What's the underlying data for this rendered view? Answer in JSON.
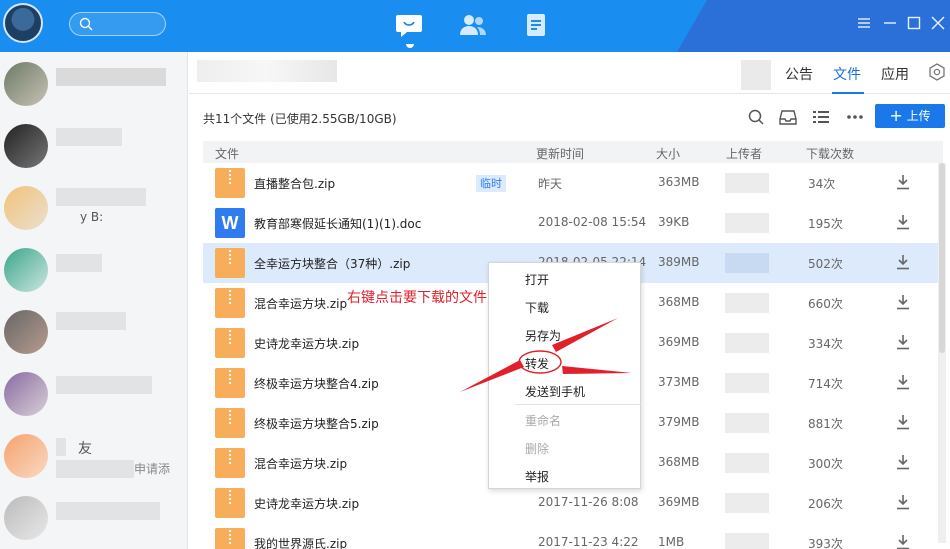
{
  "header": {
    "tabs": [
      {
        "label": "公告"
      },
      {
        "label": "文件"
      },
      {
        "label": "应用"
      }
    ]
  },
  "toolbar": {
    "summary": "共11个文件 (已使用2.55GB/10GB)",
    "upload_label": "上传"
  },
  "table": {
    "columns": [
      "文件",
      "更新时间",
      "大小",
      "上传者",
      "下载次数"
    ],
    "rows": [
      {
        "name": "直播整合包.zip",
        "tag": "临时",
        "time": "昨天",
        "size": "363MB",
        "downloads": "34次",
        "type": "zip"
      },
      {
        "name": "教育部寒假延长通知(1)(1).doc",
        "tag": "",
        "time": "2018-02-08 15:54",
        "size": "39KB",
        "downloads": "195次",
        "type": "doc",
        "icon_letter": "W"
      },
      {
        "name": "全幸运方块整合（37种）.zip",
        "tag": "",
        "time": "2018-02-05 22:14",
        "size": "389MB",
        "downloads": "502次",
        "type": "zip"
      },
      {
        "name": "混合幸运方块.zip",
        "tag": "",
        "time": "",
        "size": "368MB",
        "downloads": "660次",
        "type": "zip"
      },
      {
        "name": "史诗龙幸运方块.zip",
        "tag": "",
        "time": "",
        "size": "369MB",
        "downloads": "334次",
        "type": "zip"
      },
      {
        "name": "终极幸运方块整合4.zip",
        "tag": "",
        "time": "",
        "size": "373MB",
        "downloads": "714次",
        "type": "zip"
      },
      {
        "name": "终极幸运方块整合5.zip",
        "tag": "",
        "time": "",
        "size": "379MB",
        "downloads": "881次",
        "type": "zip"
      },
      {
        "name": "混合幸运方块.zip",
        "tag": "",
        "time": "",
        "size": "368MB",
        "downloads": "300次",
        "type": "zip"
      },
      {
        "name": "史诗龙幸运方块.zip",
        "tag": "",
        "time": "2017-11-26 8:08",
        "size": "369MB",
        "downloads": "206次",
        "type": "zip"
      },
      {
        "name": "我的世界源氏.zip",
        "tag": "",
        "time": "2017-11-23 4:22",
        "size": "1MB",
        "downloads": "393次",
        "type": "zip"
      }
    ]
  },
  "context_menu": {
    "items": [
      "打开",
      "下载",
      "另存为",
      "转发",
      "发送到手机",
      "重命名",
      "删除",
      "举报"
    ]
  },
  "annotation": "右键点击要下载的文件",
  "sidebar": {
    "snippets": [
      "y B:",
      "友",
      "申请添"
    ]
  },
  "colors": {
    "accent": "#1a78ea",
    "topbar": "#1a8ef0",
    "annotation": "#e0202a",
    "zip": "#f7ad5a"
  }
}
